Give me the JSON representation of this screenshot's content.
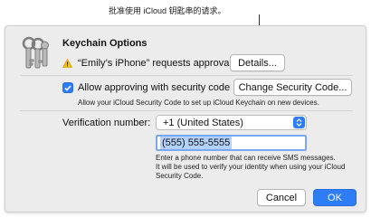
{
  "callout": {
    "text": "批准使用 iCloud 钥匙串的请求。"
  },
  "dialog": {
    "title": "Keychain Options",
    "approval_request": "“Emily’s iPhone” requests approval",
    "details_button": "Details...",
    "approve_checkbox": {
      "label": "Allow approving with security code",
      "checked": true
    },
    "change_code_button": "Change Security Code...",
    "help_text": "Allow your iCloud Security Code to set up iCloud Keychain on new devices.",
    "verification": {
      "label": "Verification number:",
      "country_value": "+1 (United States)",
      "phone_value": "(555) 555-5555",
      "description_line1": "Enter a phone number that can receive SMS messages.",
      "description_line2": "It will be used to verify your identity when using your iCloud",
      "description_line3": "Security Code."
    },
    "cancel_button": "Cancel",
    "ok_button": "OK"
  },
  "icons": {
    "app": "keychain-keys-icon",
    "warning": "warning-triangle-icon",
    "checkbox": "checkmark-icon",
    "select": "up-down-chevron-icon"
  },
  "colors": {
    "accent": "#2f7df6",
    "warning": "#f5c000",
    "dialog_bg": "#ececec",
    "selection": "#b3d2fb"
  }
}
